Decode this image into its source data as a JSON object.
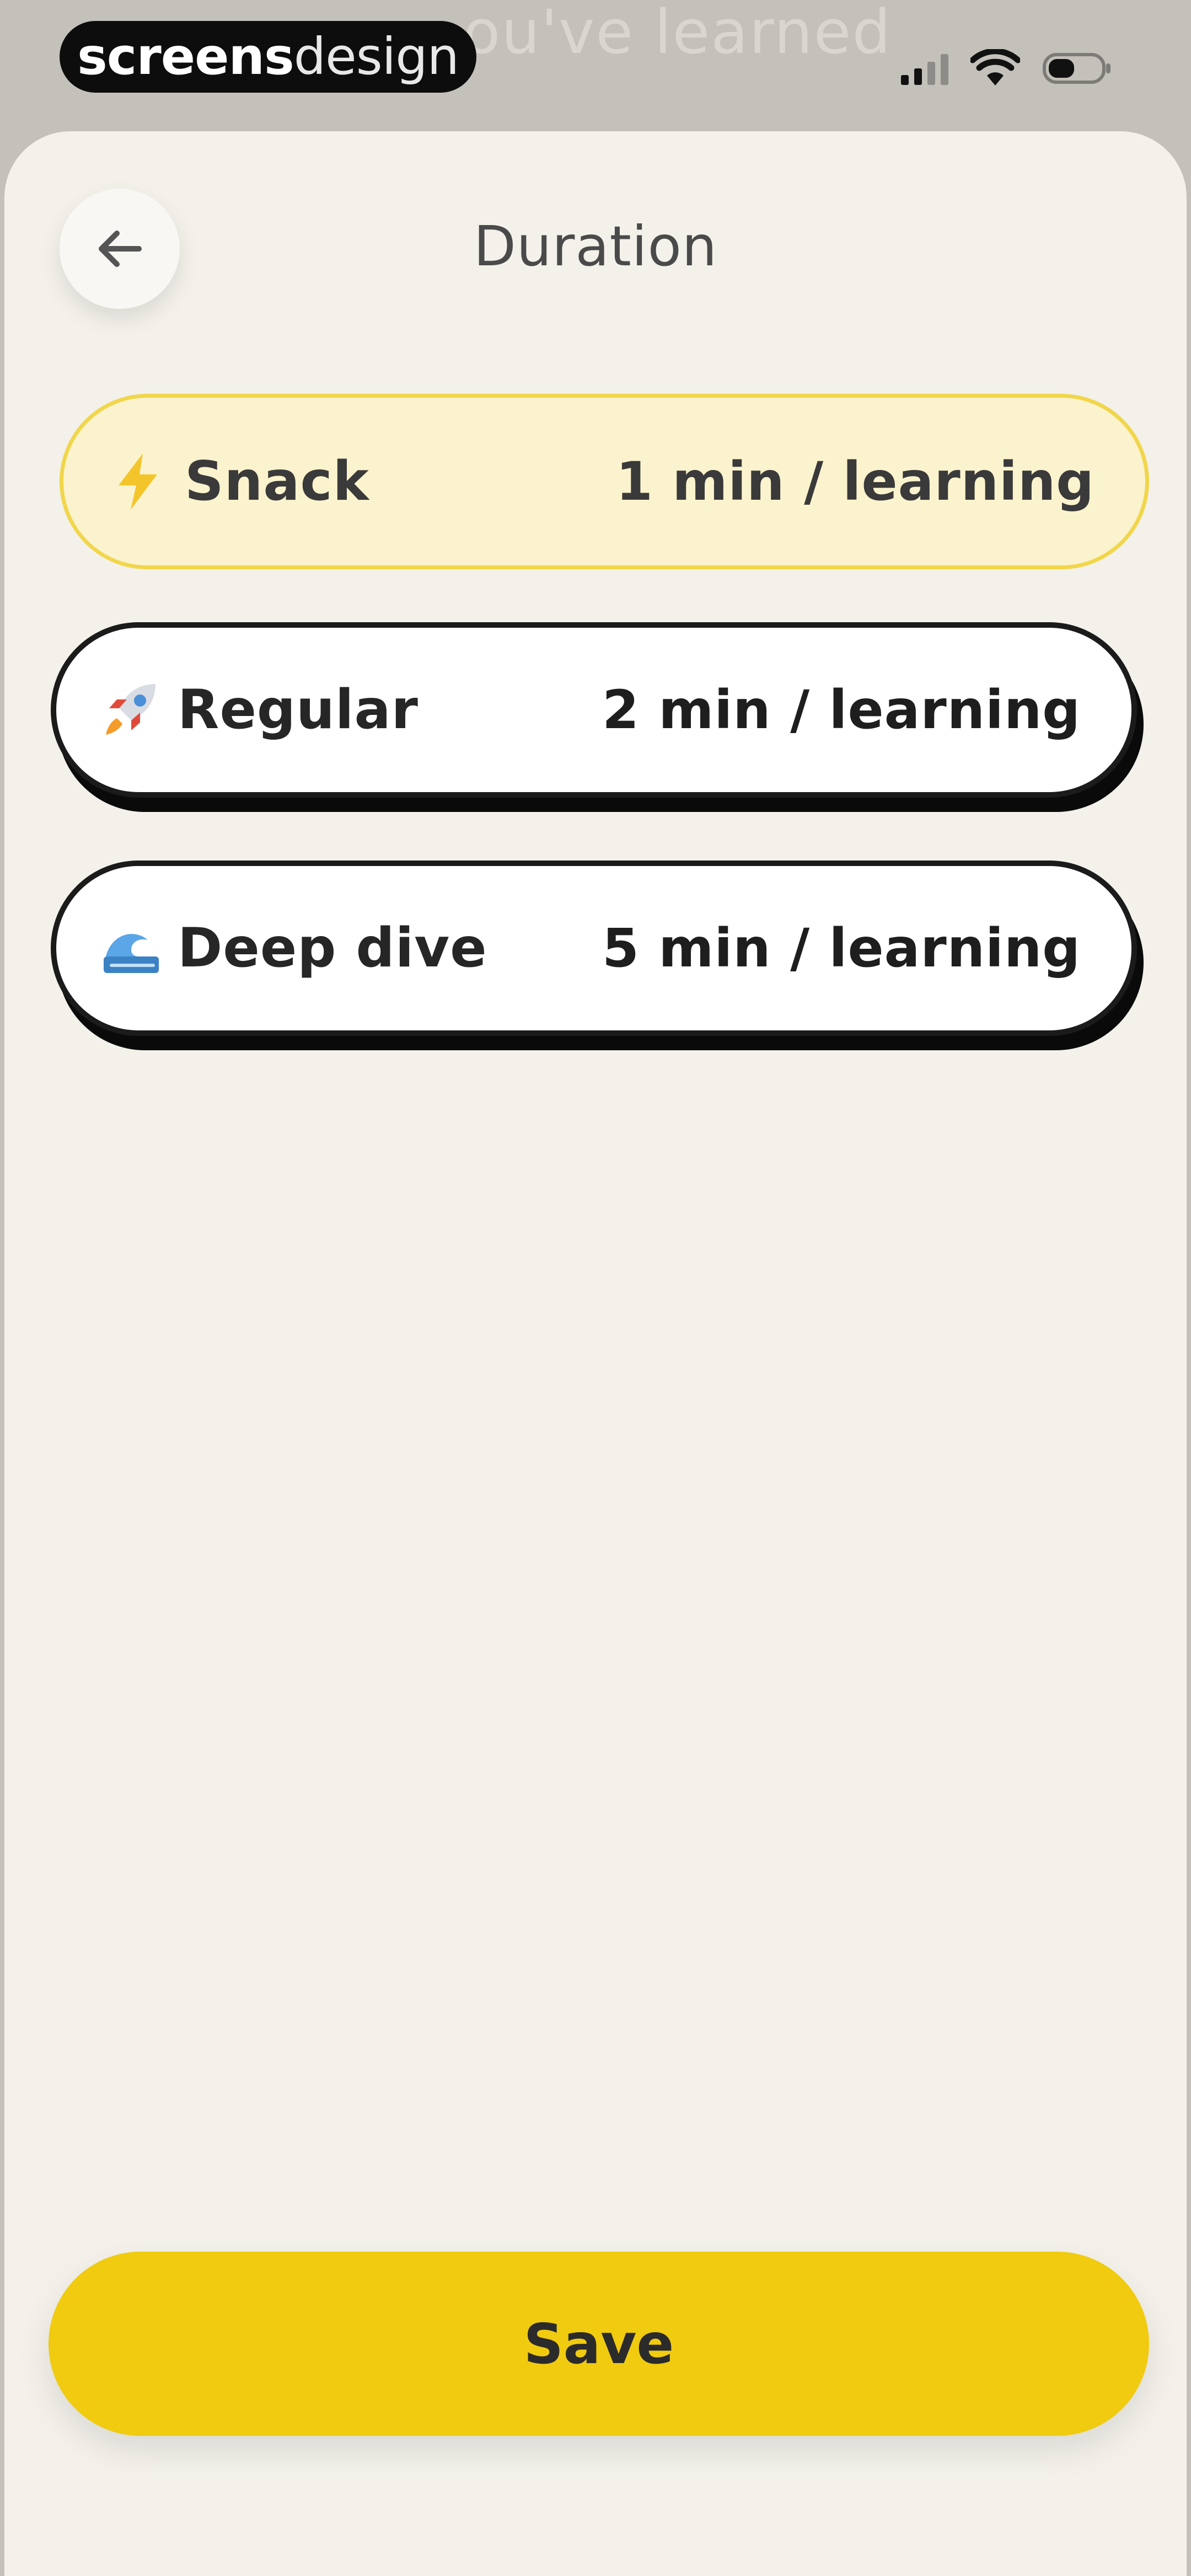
{
  "status_bar": {
    "brand_strong": "screens",
    "brand_light": "design",
    "background_peek_text": "ou've learned"
  },
  "header": {
    "title": "Duration",
    "back_icon": "arrow-left-icon"
  },
  "options": [
    {
      "icon": "lightning-icon",
      "label": "Snack",
      "meta": "1 min / learning",
      "selected": true
    },
    {
      "icon": "rocket-icon",
      "label": "Regular",
      "meta": "2 min / learning",
      "selected": false
    },
    {
      "icon": "wave-icon",
      "label": "Deep dive",
      "meta": "5 min / learning",
      "selected": false
    }
  ],
  "footer": {
    "save_label": "Save"
  },
  "colors": {
    "accent_yellow": "#f0cb0f",
    "selected_bg": "#fbf3cd",
    "selected_border": "#f1d64b",
    "sheet_bg": "#f3f1ea",
    "outline": "#1b1b1b"
  }
}
